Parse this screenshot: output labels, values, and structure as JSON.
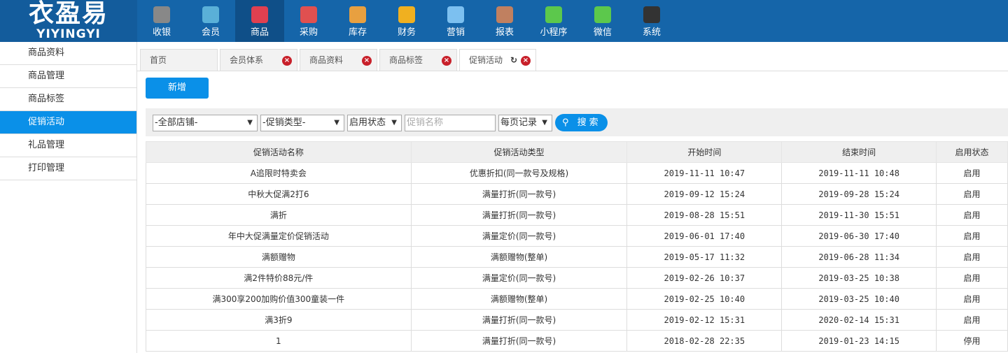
{
  "logo": {
    "cn": "衣盈易",
    "en": "YIYINGYI"
  },
  "nav": [
    {
      "label": "收银",
      "color": "#888"
    },
    {
      "label": "会员",
      "color": "#5ab0d8"
    },
    {
      "label": "商品",
      "color": "#e04050"
    },
    {
      "label": "采购",
      "color": "#e05050"
    },
    {
      "label": "库存",
      "color": "#e8a040"
    },
    {
      "label": "财务",
      "color": "#f0b020"
    },
    {
      "label": "营销",
      "color": "#7cc0f0"
    },
    {
      "label": "报表",
      "color": "#c08060"
    },
    {
      "label": "小程序",
      "color": "#5cc84c"
    },
    {
      "label": "微信",
      "color": "#5cc84c"
    },
    {
      "label": "系统",
      "color": "#333"
    }
  ],
  "sidebar": [
    "商品资料",
    "商品管理",
    "商品标签",
    "促销活动",
    "礼品管理",
    "打印管理"
  ],
  "tabs": [
    "首页",
    "会员体系",
    "商品资料",
    "商品标签",
    "促销活动"
  ],
  "add_label": "新增",
  "filter": {
    "store": "-全部店铺-",
    "type": "-促销类型-",
    "status": "启用状态",
    "name_placeholder": "促销名称",
    "page": "每页记录",
    "search": "搜索"
  },
  "table": {
    "headers": [
      "促销活动名称",
      "促销活动类型",
      "开始时间",
      "结束时间",
      "启用状态"
    ],
    "rows": [
      [
        "A追限时特卖会",
        "优惠折扣(同一款号及规格)",
        "2019-11-11 10:47",
        "2019-11-11 10:48",
        "启用"
      ],
      [
        "中秋大促满2打6",
        "满量打折(同一款号)",
        "2019-09-12 15:24",
        "2019-09-28 15:24",
        "启用"
      ],
      [
        "满折",
        "满量打折(同一款号)",
        "2019-08-28 15:51",
        "2019-11-30 15:51",
        "启用"
      ],
      [
        "年中大促满量定价促销活动",
        "满量定价(同一款号)",
        "2019-06-01 17:40",
        "2019-06-30 17:40",
        "启用"
      ],
      [
        "满额赠物",
        "满额赠物(整单)",
        "2019-05-17 11:32",
        "2019-06-28 11:34",
        "启用"
      ],
      [
        "满2件特价88元/件",
        "满量定价(同一款号)",
        "2019-02-26 10:37",
        "2019-03-25 10:38",
        "启用"
      ],
      [
        "满300享200加购价值300童装一件",
        "满额赠物(整单)",
        "2019-02-25 10:40",
        "2019-03-25 10:40",
        "启用"
      ],
      [
        "满3折9",
        "满量打折(同一款号)",
        "2019-02-12 15:31",
        "2020-02-14 15:31",
        "启用"
      ],
      [
        "1",
        "满量打折(同一款号)",
        "2018-02-28 22:35",
        "2019-01-23 14:15",
        "停用"
      ]
    ]
  }
}
